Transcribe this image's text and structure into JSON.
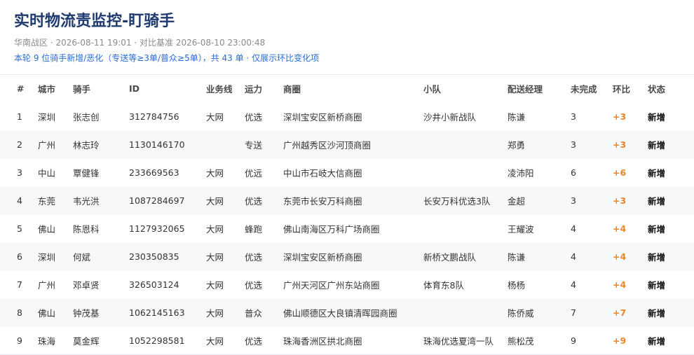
{
  "header": {
    "title": "实时物流责监控-盯骑手",
    "subtitle": "华南战区 · 2026-08-11 19:01 · 对比基准 2026-08-10 23:00:48",
    "notice": "本轮 9 位骑手新增/恶化（专送等≥3单/普众≥5单），共 43 单 · 仅展示环比变化项"
  },
  "table": {
    "columns": [
      "#",
      "城市",
      "骑手",
      "ID",
      "业务线",
      "运力",
      "商圈",
      "小队",
      "配送经理",
      "未完成",
      "环比",
      "状态"
    ],
    "rows": [
      [
        "1",
        "深圳",
        "张志创",
        "312784756",
        "大网",
        "优选",
        "深圳宝安区新桥商圈",
        "沙井小新战队",
        "陈谦",
        "3",
        "+3",
        "新增"
      ],
      [
        "2",
        "广州",
        "林志玲",
        "1130146170",
        "",
        "专送",
        "广州越秀区沙河顶商圈",
        "",
        "郑勇",
        "3",
        "+3",
        "新增"
      ],
      [
        "3",
        "中山",
        "覃健锋",
        "233669563",
        "大网",
        "优远",
        "中山市石岐大信商圈",
        "",
        "凌沛阳",
        "6",
        "+6",
        "新增"
      ],
      [
        "4",
        "东莞",
        "韦光洪",
        "1087284697",
        "大网",
        "优选",
        "东莞市长安万科商圈",
        "长安万科优选3队",
        "金超",
        "3",
        "+3",
        "新增"
      ],
      [
        "5",
        "佛山",
        "陈恩科",
        "1127932065",
        "大网",
        "蜂跑",
        "佛山南海区万科广场商圈",
        "",
        "王耀波",
        "4",
        "+4",
        "新增"
      ],
      [
        "6",
        "深圳",
        "何斌",
        "230350835",
        "大网",
        "优选",
        "深圳宝安区新桥商圈",
        "新桥文鹏战队",
        "陈谦",
        "4",
        "+4",
        "新增"
      ],
      [
        "7",
        "广州",
        "邓卓贤",
        "326503124",
        "大网",
        "优选",
        "广州天河区广州东站商圈",
        "体育东8队",
        "杨杨",
        "4",
        "+4",
        "新增"
      ],
      [
        "8",
        "佛山",
        "钟茂基",
        "1062145163",
        "大网",
        "普众",
        "佛山顺德区大良镇清晖园商圈",
        "",
        "陈侨威",
        "7",
        "+7",
        "新增"
      ],
      [
        "9",
        "珠海",
        "莫金辉",
        "1052298581",
        "大网",
        "优选",
        "珠海香洲区拱北商圈",
        "珠海优选夏湾一队",
        "熊松茂",
        "9",
        "+9",
        "新增"
      ]
    ]
  },
  "colors": {
    "title": "#1f3a6e",
    "notice": "#2a6bd8",
    "delta": "#e8862a",
    "row_alt": "#f7f8fa"
  }
}
